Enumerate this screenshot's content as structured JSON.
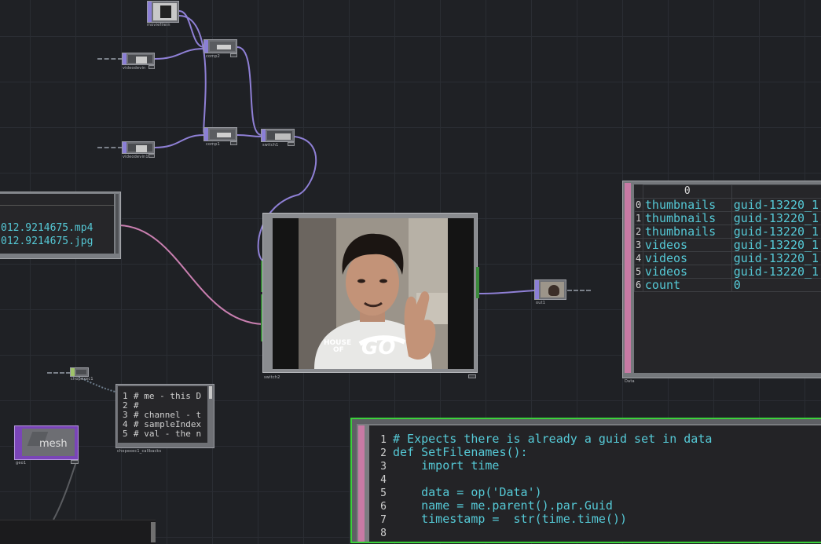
{
  "files_table": {
    "rows": [
      "012.9214675.mp4",
      "012.9214675.jpg"
    ]
  },
  "data_table": {
    "column_header": "0",
    "rows": [
      {
        "index": "0",
        "key": "thumbnails",
        "value": "guid-13220_1"
      },
      {
        "index": "1",
        "key": "thumbnails",
        "value": "guid-13220_1"
      },
      {
        "index": "2",
        "key": "thumbnails",
        "value": "guid-13220_1"
      },
      {
        "index": "3",
        "key": "videos",
        "value": "guid-13220_1"
      },
      {
        "index": "4",
        "key": "videos",
        "value": "guid-13220_1"
      },
      {
        "index": "5",
        "key": "videos",
        "value": "guid-13220_1"
      },
      {
        "index": "6",
        "key": "count",
        "value": "0"
      }
    ]
  },
  "small_code": {
    "lines": [
      {
        "n": "1",
        "text": "# me - this D"
      },
      {
        "n": "2",
        "text": "#"
      },
      {
        "n": "3",
        "text": "# channel - t"
      },
      {
        "n": "4",
        "text": "# sampleIndex"
      },
      {
        "n": "5",
        "text": "# val - the n"
      }
    ]
  },
  "code_panel": {
    "lines": [
      {
        "n": "1",
        "text": "# Expects there is already a guid set in data"
      },
      {
        "n": "2",
        "text": "def SetFilenames():"
      },
      {
        "n": "3",
        "text": "    import time"
      },
      {
        "n": "4",
        "text": ""
      },
      {
        "n": "5",
        "text": "    data = op('Data')"
      },
      {
        "n": "6",
        "text": "    name = me.parent().par.Guid"
      },
      {
        "n": "7",
        "text": "    timestamp =  str(time.time())"
      },
      {
        "n": "8",
        "text": ""
      }
    ]
  },
  "mesh_node": {
    "label": "mesh"
  },
  "video": {
    "overlay_text_1": "HOUSE",
    "overlay_text_2": "OF",
    "overlay_text_3": "GO"
  },
  "colors": {
    "wire_purple": "#8f80d6",
    "wire_pink": "#c97fb0",
    "code_cyan": "#55c9d6",
    "selection_green": "#3bd13b",
    "background": "#1f2125"
  }
}
